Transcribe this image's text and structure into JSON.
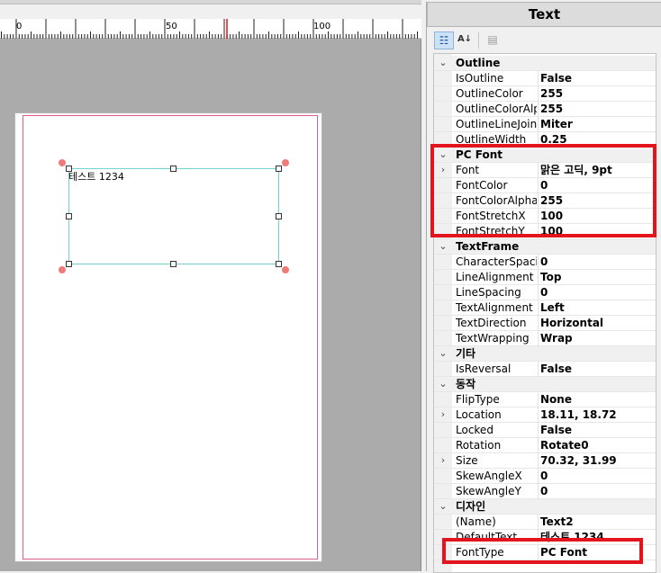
{
  "ruler": {
    "labels": [
      "0",
      "50",
      "100"
    ]
  },
  "canvas": {
    "sample_text": "테스트 1234"
  },
  "panel": {
    "title": "Text",
    "toolbar": {
      "categorized_icon": "categorized-view-icon",
      "alpha_icon": "alphabetical-sort-icon",
      "pages_icon": "property-pages-icon"
    },
    "rows": [
      {
        "type": "cat",
        "label": "Outline"
      },
      {
        "type": "prop",
        "name": "IsOutline",
        "value": "False"
      },
      {
        "type": "prop",
        "name": "OutlineColor",
        "value": "255"
      },
      {
        "type": "prop",
        "name": "OutlineColorAlpl",
        "value": "255"
      },
      {
        "type": "prop",
        "name": "OutlineLineJoin",
        "value": "Miter"
      },
      {
        "type": "prop",
        "name": "OutlineWidth",
        "value": "0.25"
      },
      {
        "type": "cat",
        "label": "PC Font"
      },
      {
        "type": "prop",
        "name": "Font",
        "value": "맑은 고딕, 9pt",
        "expandable": true
      },
      {
        "type": "prop",
        "name": "FontColor",
        "value": "0"
      },
      {
        "type": "prop",
        "name": "FontColorAlpha",
        "value": "255"
      },
      {
        "type": "prop",
        "name": "FontStretchX",
        "value": "100"
      },
      {
        "type": "prop",
        "name": "FontStretchY",
        "value": "100"
      },
      {
        "type": "cat",
        "label": "TextFrame"
      },
      {
        "type": "prop",
        "name": "CharacterSpacii",
        "value": "0"
      },
      {
        "type": "prop",
        "name": "LineAlignment",
        "value": "Top"
      },
      {
        "type": "prop",
        "name": "LineSpacing",
        "value": "0"
      },
      {
        "type": "prop",
        "name": "TextAlignment",
        "value": "Left"
      },
      {
        "type": "prop",
        "name": "TextDirection",
        "value": "Horizontal"
      },
      {
        "type": "prop",
        "name": "TextWrapping",
        "value": "Wrap"
      },
      {
        "type": "cat",
        "label": "기타"
      },
      {
        "type": "prop",
        "name": "IsReversal",
        "value": "False"
      },
      {
        "type": "cat",
        "label": "동작"
      },
      {
        "type": "prop",
        "name": "FlipType",
        "value": "None"
      },
      {
        "type": "prop",
        "name": "Location",
        "value": "18.11, 18.72",
        "expandable": true
      },
      {
        "type": "prop",
        "name": "Locked",
        "value": "False"
      },
      {
        "type": "prop",
        "name": "Rotation",
        "value": "Rotate0"
      },
      {
        "type": "prop",
        "name": "Size",
        "value": "70.32, 31.99",
        "expandable": true
      },
      {
        "type": "prop",
        "name": "SkewAngleX",
        "value": "0"
      },
      {
        "type": "prop",
        "name": "SkewAngleY",
        "value": "0"
      },
      {
        "type": "cat",
        "label": "디자인"
      },
      {
        "type": "prop",
        "name": "(Name)",
        "value": "Text2"
      },
      {
        "type": "prop",
        "name": "DefaultText",
        "value": "테스트 1234"
      },
      {
        "type": "prop",
        "name": "FontType",
        "value": "PC Font"
      }
    ]
  },
  "colors": {
    "highlight": "#e3141b",
    "frame": "#6fd4d0",
    "margin": "#e35d8a",
    "rotate_handle": "#f07a7a"
  }
}
